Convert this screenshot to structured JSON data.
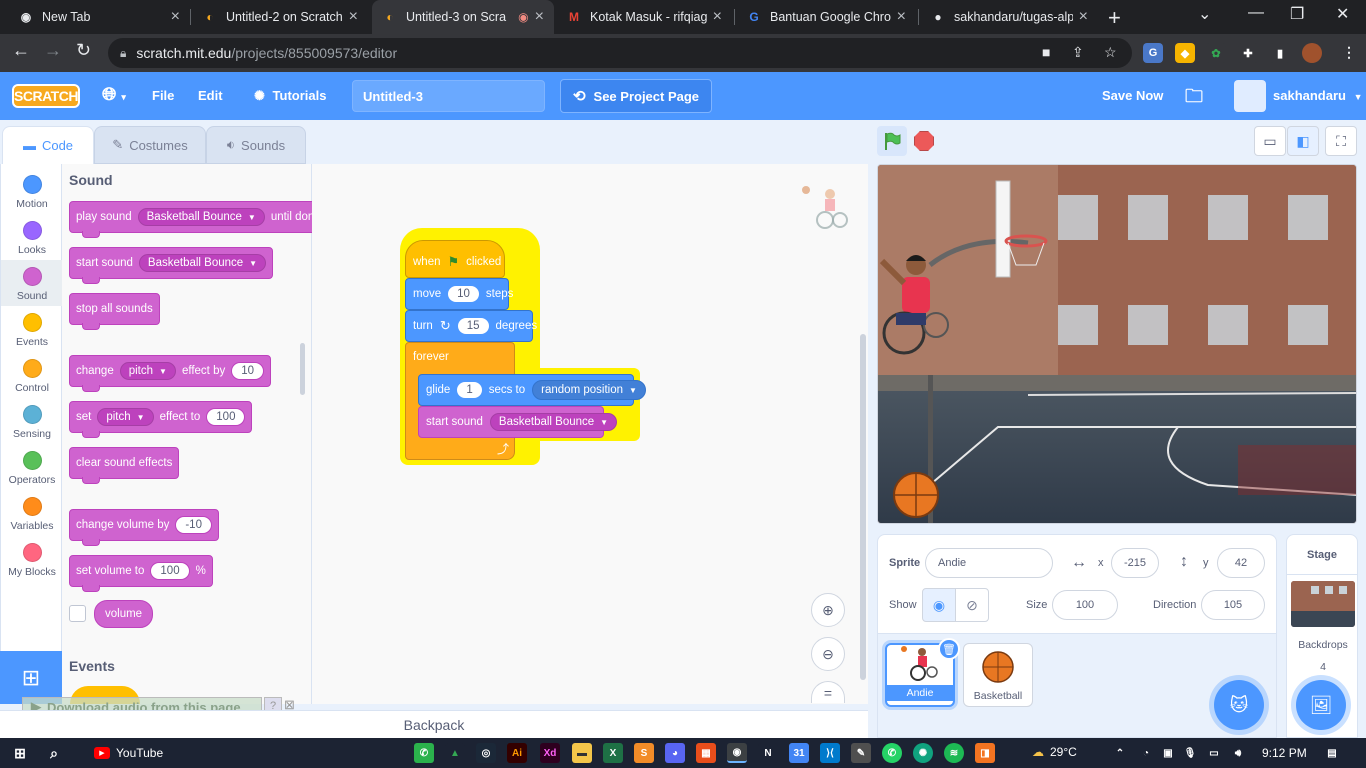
{
  "browser": {
    "tabs": [
      {
        "title": "New Tab"
      },
      {
        "title": "Untitled-2 on Scratch"
      },
      {
        "title": "Untitled-3 on Scra"
      },
      {
        "title": "Kotak Masuk - rifqiagl"
      },
      {
        "title": "Bantuan Google Chro"
      },
      {
        "title": "sakhandaru/tugas-alp"
      }
    ],
    "url_host": "scratch.mit.edu",
    "url_path": "/projects/855009573/editor"
  },
  "menu": {
    "logo": "SCRATCH",
    "file": "File",
    "edit": "Edit",
    "tutorials": "Tutorials",
    "project_title": "Untitled-3",
    "see_project": "See Project Page",
    "save_now": "Save Now",
    "username": "sakhandaru"
  },
  "editor_tabs": {
    "code": "Code",
    "costumes": "Costumes",
    "sounds": "Sounds"
  },
  "categories": [
    {
      "label": "Motion",
      "color": "#4c97ff"
    },
    {
      "label": "Looks",
      "color": "#9966ff"
    },
    {
      "label": "Sound",
      "color": "#cf63cf"
    },
    {
      "label": "Events",
      "color": "#ffbf00"
    },
    {
      "label": "Control",
      "color": "#ffab19"
    },
    {
      "label": "Sensing",
      "color": "#5cb1d6"
    },
    {
      "label": "Operators",
      "color": "#59c059"
    },
    {
      "label": "Variables",
      "color": "#ff8c1a"
    },
    {
      "label": "My Blocks",
      "color": "#ff6680"
    }
  ],
  "palette": {
    "sound_heading": "Sound",
    "events_heading": "Events",
    "play_sound": "play sound",
    "basketball_bounce": "Basketball Bounce",
    "until_done": "until done",
    "start_sound": "start sound",
    "stop_all_sounds": "stop all sounds",
    "change": "change",
    "pitch": "pitch",
    "effect_by": "effect by",
    "effect_by_val": "10",
    "set": "set",
    "effect_to": "effect to",
    "effect_to_val": "100",
    "clear_sound_effects": "clear sound effects",
    "change_volume_by": "change volume by",
    "change_volume_val": "-10",
    "set_volume_to": "set volume to",
    "set_volume_val": "100",
    "percent": "%",
    "volume": "volume"
  },
  "script": {
    "when": "when",
    "clicked": "clicked",
    "move": "move",
    "move_val": "10",
    "steps": "steps",
    "turn": "turn",
    "turn_val": "15",
    "degrees": "degrees",
    "forever": "forever",
    "glide": "glide",
    "glide_val": "1",
    "secs_to": "secs to",
    "random_position": "random position",
    "start_sound": "start sound",
    "sound_name": "Basketball Bounce"
  },
  "download_bar": "Download audio from this page",
  "backpack": "Backpack",
  "sprite_info": {
    "sprite_label": "Sprite",
    "sprite_name": "Andie",
    "x_label": "x",
    "x_val": "-215",
    "y_label": "y",
    "y_val": "42",
    "show_label": "Show",
    "size_label": "Size",
    "size_val": "100",
    "direction_label": "Direction",
    "direction_val": "105"
  },
  "sprites": [
    {
      "name": "Andie"
    },
    {
      "name": "Basketball"
    }
  ],
  "stage_panel": {
    "heading": "Stage",
    "backdrops_label": "Backdrops",
    "backdrops_count": "4"
  },
  "taskbar": {
    "youtube": "YouTube",
    "weather": "29°C",
    "time": "9:12 PM"
  }
}
